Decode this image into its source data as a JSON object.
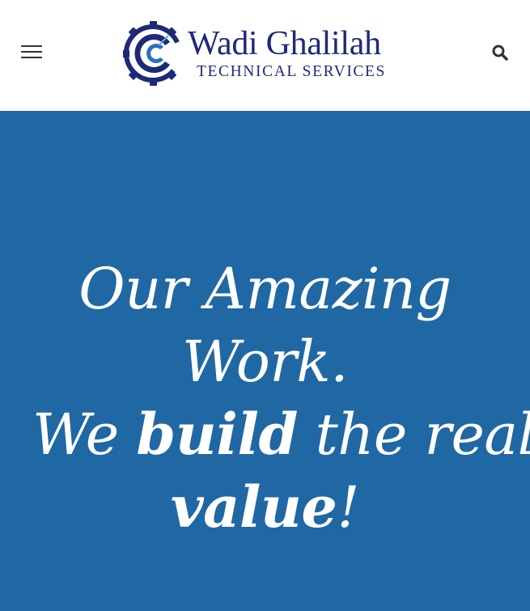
{
  "header": {
    "logo": {
      "name": "Wadi Ghalilah",
      "subtitle": "TECHNICAL SERVICES"
    },
    "menu_icon": "hamburger-menu-icon",
    "search_icon": "search-icon"
  },
  "hero": {
    "line1": "Our Amazing",
    "line2": "Work.",
    "line3_pre": "We ",
    "line3_bold": "build",
    "line3_post": " the real",
    "line4_bold": "value",
    "line4_post": "!"
  },
  "colors": {
    "hero_bg": "#2068a4",
    "brand_navy": "#1e2a78",
    "header_bg": "#ffffff"
  }
}
